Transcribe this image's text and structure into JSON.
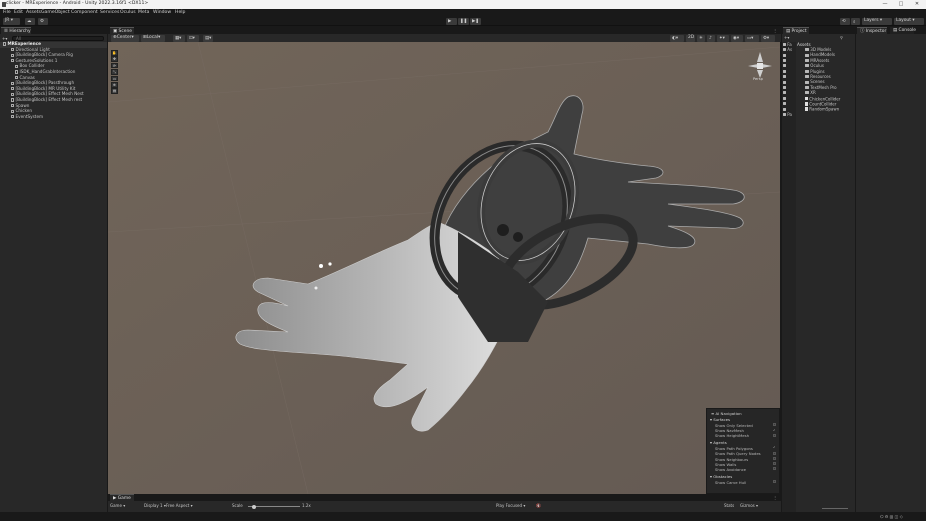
{
  "window": {
    "title": "clicker - MRExperience - Android - Unity 2022.3.16f1 <DX11>",
    "minimize": "—",
    "maximize": "□",
    "close": "✕"
  },
  "menu": [
    "File",
    "Edit",
    "Assets",
    "GameObject",
    "Component",
    "Services",
    "Oculus",
    "Meta",
    "Window",
    "Help"
  ],
  "toolbar": {
    "account_label": "JR",
    "layers_label": "Layers",
    "layout_label": "Layout"
  },
  "hierarchy": {
    "tab": "Hierarchy",
    "search_placeholder": "All",
    "items": [
      {
        "label": "MRExperience",
        "indent": 0,
        "bold": true,
        "icon": "unity-icon"
      },
      {
        "label": "Directional Light",
        "indent": 2,
        "icon": "cube-icon"
      },
      {
        "label": "[BuildingBlock] Camera Rig",
        "indent": 2,
        "icon": "cube-icon"
      },
      {
        "label": "GesturesSolutions 1",
        "indent": 2,
        "icon": "cube-icon"
      },
      {
        "label": "Box Collider",
        "indent": 3,
        "icon": "cube-icon"
      },
      {
        "label": "ISDK_HandGrabInteraction",
        "indent": 3,
        "icon": "cube-icon"
      },
      {
        "label": "Canvas",
        "indent": 3,
        "icon": "cube-icon"
      },
      {
        "label": "[BuildingBlock] Passthrough",
        "indent": 2,
        "icon": "cube-icon"
      },
      {
        "label": "[BuildingBlock] MR Utility Kit",
        "indent": 2,
        "icon": "cube-icon"
      },
      {
        "label": "[BuildingBlock] Effect Mesh Nest",
        "indent": 2,
        "icon": "cube-icon"
      },
      {
        "label": "[BuildingBlock] Effect Mesh rest",
        "indent": 2,
        "icon": "cube-icon"
      },
      {
        "label": "Spawn",
        "indent": 2,
        "icon": "cube-icon"
      },
      {
        "label": "Chicken",
        "indent": 2,
        "icon": "cube-icon"
      },
      {
        "label": "EventSystem",
        "indent": 2,
        "icon": "cube-icon"
      }
    ]
  },
  "scene": {
    "tab": "Scene",
    "draw_mode": "Center",
    "pivot_mode": "Local",
    "view_2d": "2D",
    "gizmo_label": "Persp",
    "side_tools": [
      "✋",
      "✥",
      "⟳",
      "⤡",
      "▭",
      "⊕",
      "▤"
    ]
  },
  "ai_navigation": {
    "title": "AI Navigation",
    "sections": [
      {
        "name": "Surfaces",
        "rows": [
          {
            "label": "Show Only Selected",
            "checked": false
          },
          {
            "label": "Show NavMesh",
            "checked": true
          },
          {
            "label": "Show HeightMesh",
            "checked": false
          }
        ]
      },
      {
        "name": "Agents",
        "rows": [
          {
            "label": "Show Path Polygons",
            "checked": true
          },
          {
            "label": "Show Path Query Nodes",
            "checked": false
          },
          {
            "label": "Show Neighbours",
            "checked": false
          },
          {
            "label": "Show Walls",
            "checked": false
          },
          {
            "label": "Show Avoidance",
            "checked": false
          }
        ]
      },
      {
        "name": "Obstacles",
        "rows": [
          {
            "label": "Show Carve Hull",
            "checked": false
          }
        ]
      }
    ]
  },
  "game": {
    "tab": "Game",
    "mode": "Game",
    "display": "Display 1",
    "aspect": "Free Aspect",
    "scale_label": "Scale",
    "scale_value": "1.2x",
    "play_focused": "Play Focused",
    "stats": "Stats",
    "gizmos": "Gizmos"
  },
  "project": {
    "tab": "Project",
    "favorites": "Favorites",
    "assets_header": "Assets",
    "items": [
      {
        "label": "3D Models",
        "type": "folder"
      },
      {
        "label": "HandModels",
        "type": "folder"
      },
      {
        "label": "MRAssets",
        "type": "folder"
      },
      {
        "label": "Oculus",
        "type": "folder"
      },
      {
        "label": "Plugins",
        "type": "folder"
      },
      {
        "label": "Resources",
        "type": "folder"
      },
      {
        "label": "Scenes",
        "type": "folder"
      },
      {
        "label": "TextMesh Pro",
        "type": "folder"
      },
      {
        "label": "XR",
        "type": "folder"
      },
      {
        "label": "ChickenCollider",
        "type": "file"
      },
      {
        "label": "CountCollider",
        "type": "file"
      },
      {
        "label": "RandomSpawn",
        "type": "file"
      }
    ],
    "left_tree": [
      "Fa",
      "As",
      "",
      "",
      "",
      "",
      "",
      "",
      "",
      "",
      "",
      "",
      "",
      "Pa"
    ]
  },
  "inspector": {
    "tab": "Inspector",
    "console_tab": "Console"
  },
  "colors": {
    "scene_bg": "#6b5f57",
    "panel": "#282828",
    "dark": "#191919",
    "accent": "#3a79bb"
  }
}
